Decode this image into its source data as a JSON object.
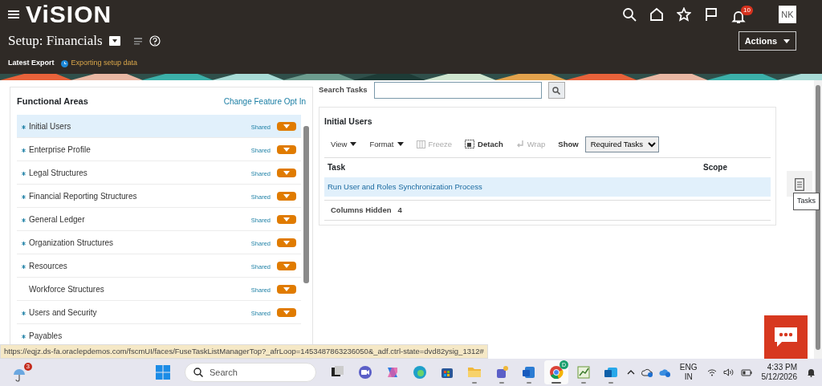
{
  "header": {
    "logo": "ViSION",
    "notifications": "10",
    "avatar": "NK",
    "title": "Setup: Financials",
    "actions": "Actions",
    "export_label": "Latest Export",
    "export_status": "Exporting setup data"
  },
  "functional_areas": {
    "title": "Functional Areas",
    "link": "Change Feature Opt In",
    "items": [
      {
        "name": "Initial Users",
        "required": true,
        "selected": true,
        "scope": "Shared"
      },
      {
        "name": "Enterprise Profile",
        "required": true,
        "selected": false,
        "scope": "Shared"
      },
      {
        "name": "Legal Structures",
        "required": true,
        "selected": false,
        "scope": "Shared"
      },
      {
        "name": "Financial Reporting Structures",
        "required": true,
        "selected": false,
        "scope": "Shared"
      },
      {
        "name": "General Ledger",
        "required": true,
        "selected": false,
        "scope": "Shared"
      },
      {
        "name": "Organization Structures",
        "required": true,
        "selected": false,
        "scope": "Shared"
      },
      {
        "name": "Resources",
        "required": true,
        "selected": false,
        "scope": "Shared"
      },
      {
        "name": "Workforce Structures",
        "required": false,
        "selected": false,
        "scope": "Shared"
      },
      {
        "name": "Users and Security",
        "required": true,
        "selected": false,
        "scope": "Shared"
      },
      {
        "name": "Payables",
        "required": true,
        "selected": false
      }
    ]
  },
  "search": {
    "label": "Search Tasks"
  },
  "tasks": {
    "title": "Initial Users",
    "toolbar": [
      {
        "kind": "menu",
        "label": "View",
        "disabled": false
      },
      {
        "kind": "menu",
        "label": "Format",
        "disabled": false
      },
      {
        "kind": "freeze",
        "label": "Freeze",
        "disabled": true
      },
      {
        "kind": "detach",
        "label": "Detach",
        "disabled": false
      },
      {
        "kind": "wrap",
        "label": "Wrap",
        "disabled": true
      }
    ],
    "show_label": "Show",
    "show_value": "Required Tasks",
    "columns": [
      "Task",
      "Scope"
    ],
    "rows": [
      {
        "task": "Run User and Roles Synchronization Process",
        "selected": true
      }
    ],
    "hidden_label": "Columns Hidden",
    "hidden_count": "4"
  },
  "side_tab": {
    "tooltip": "Tasks"
  },
  "status_url": "https://eqjz.ds-fa.oraclepdemos.com/fscmUI/faces/FuseTaskListManagerTop?_afrLoop=1453487863236050&_adf.ctrl-state=dvd82ysig_1312#",
  "taskbar": {
    "weather_badge": "3",
    "search_placeholder": "Search",
    "apps": [
      {
        "kind": "taskview",
        "running": false,
        "active": false
      },
      {
        "kind": "meet",
        "running": false,
        "active": false
      },
      {
        "kind": "copilot",
        "running": false,
        "active": false
      },
      {
        "kind": "edge",
        "running": false,
        "active": false
      },
      {
        "kind": "store",
        "running": false,
        "active": false
      },
      {
        "kind": "files",
        "running": true,
        "active": false
      },
      {
        "kind": "teams",
        "running": true,
        "active": false
      },
      {
        "kind": "word",
        "running": true,
        "active": false
      },
      {
        "kind": "chrome",
        "running": true,
        "active": true,
        "badge": "D"
      },
      {
        "kind": "sheet",
        "running": true,
        "active": false
      },
      {
        "kind": "outlook",
        "running": true,
        "active": false
      }
    ],
    "lang": "ENG",
    "region": "IN",
    "time": "4:33 PM",
    "date": "5/12/2026"
  }
}
